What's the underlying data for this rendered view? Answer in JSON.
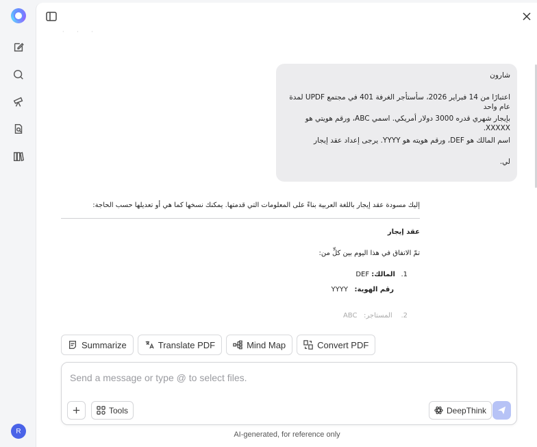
{
  "rail": {
    "avatar_initial": "R"
  },
  "conversation": {
    "user_message": [
      "شارون",
      "اعتبارًا من 14 فبراير 2026، سأستأجر الغرفة 401 في مجتمع UPDF لمدة عام واحد",
      "بإيجار شهري قدره 3000 دولار أمريكي. اسمي ABC، ورقم هويتي هو XXXXX.",
      "اسم المالك هو DEF، ورقم هويته هو YYYY. يرجى إعداد عقد إيجار",
      "لي."
    ],
    "assistant": {
      "intro": "إليك مسودة عقد إيجار باللغة العربية بناءً على المعلومات التي قدمتها. يمكنك نسخها كما هي أو تعديلها حسب الحاجة:",
      "heading": "عقد إيجار",
      "agreement_line": "تمّ الاتفاق في هذا اليوم بين كلٍّ من:",
      "item1_num": "1.",
      "item1_label": "المالك:",
      "item1_value": "DEF",
      "item1_id_label": "رقم الهوية:",
      "item1_id_value": "YYYY",
      "item2_num": "2.",
      "item2_label": "المستأجر:",
      "item2_value": "ABC"
    }
  },
  "quick_actions": [
    {
      "label": "Summarize"
    },
    {
      "label": "Translate PDF"
    },
    {
      "label": "Mind Map"
    },
    {
      "label": "Convert PDF"
    }
  ],
  "composer": {
    "placeholder": "Send a message or type @ to select files.",
    "tools_label": "Tools",
    "deepthink_label": "DeepThink"
  },
  "footer": {
    "note": "AI-generated, for reference only"
  },
  "colors": {
    "accent": "#4a63e8",
    "send_disabled": "#b7c3f6",
    "bubble": "#ececee"
  }
}
